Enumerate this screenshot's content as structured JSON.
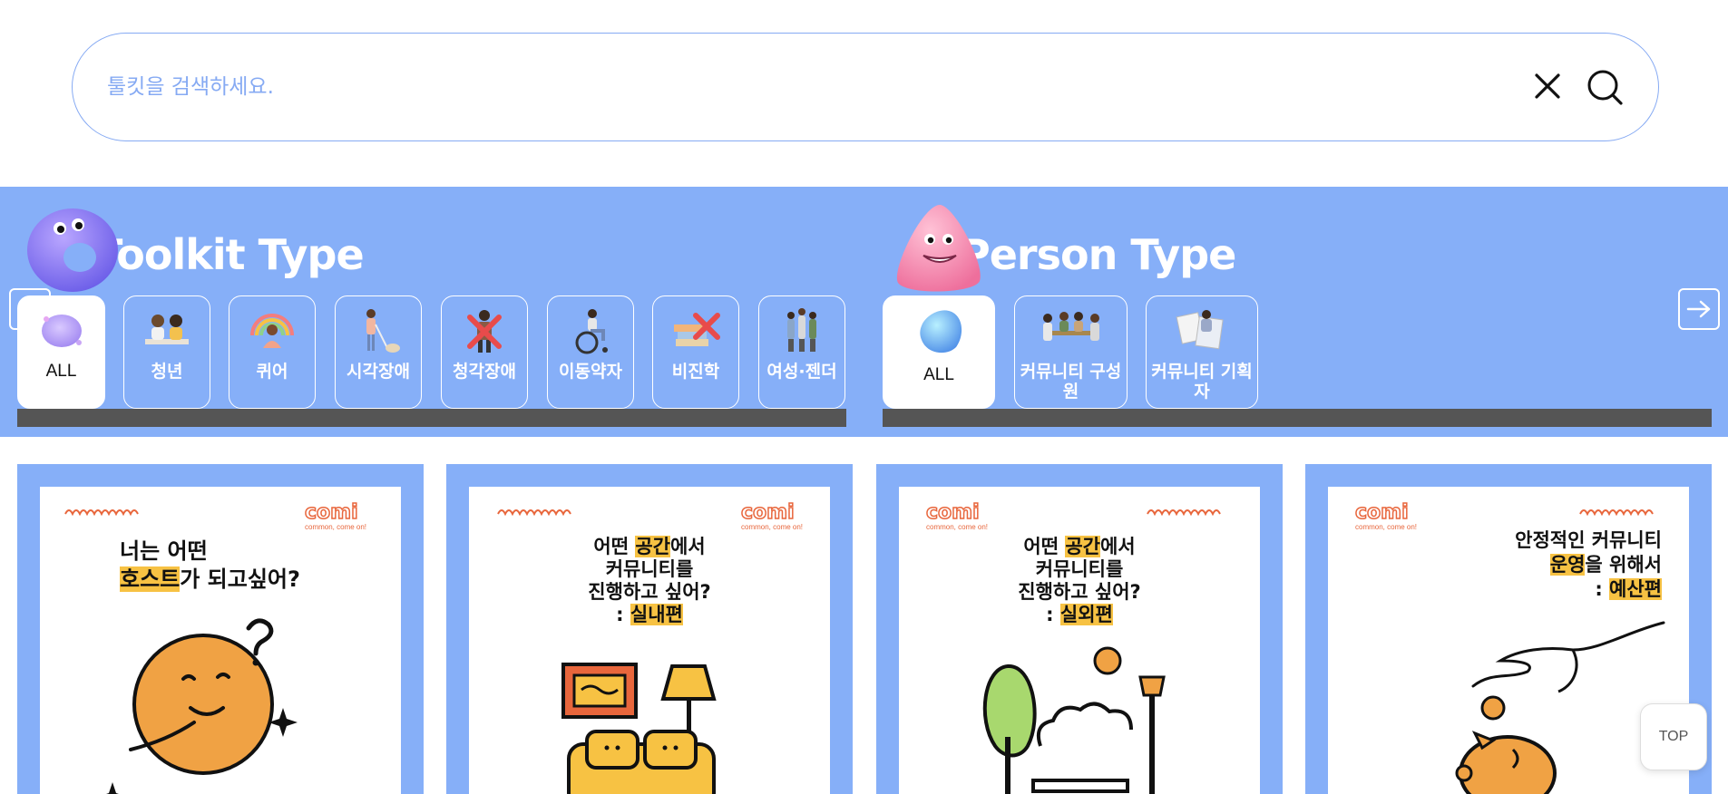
{
  "search": {
    "placeholder": "툴킷을 검색하세요."
  },
  "toolkit_section": {
    "title": "Toolkit Type",
    "chips": [
      {
        "label": "ALL",
        "icon": "blob-icon"
      },
      {
        "label": "청년",
        "icon": "youth-icon"
      },
      {
        "label": "퀴어",
        "icon": "queer-icon"
      },
      {
        "label": "시각장애",
        "icon": "visual-impairment-icon"
      },
      {
        "label": "청각장애",
        "icon": "hearing-impairment-icon"
      },
      {
        "label": "이동약자",
        "icon": "wheelchair-icon"
      },
      {
        "label": "비진학",
        "icon": "books-icon"
      },
      {
        "label": "여성·젠더",
        "icon": "gender-icon"
      }
    ]
  },
  "person_section": {
    "title": "Person Type",
    "chips": [
      {
        "label": "ALL",
        "icon": "crystal-icon"
      },
      {
        "label": "커뮤니티 구성원",
        "icon": "members-icon"
      },
      {
        "label": "커뮤니티 기획자",
        "icon": "planner-icon"
      }
    ]
  },
  "cards": [
    {
      "logo": "comi",
      "logo_sub": "common, come on!",
      "line1": "너는 어떤",
      "line2_hl": "호스트",
      "line2_rest": "가 되고싶어?"
    },
    {
      "logo": "comi",
      "logo_sub": "common, come on!",
      "line1_pre": "어떤 ",
      "line1_hl": "공간",
      "line1_post": "에서",
      "line2": "커뮤니티를",
      "line3": "진행하고 싶어?",
      "line4_pre": ": ",
      "line4_hl": "실내편"
    },
    {
      "logo": "comi",
      "logo_sub": "common, come on!",
      "line1_pre": "어떤 ",
      "line1_hl": "공간",
      "line1_post": "에서",
      "line2": "커뮤니티를",
      "line3": "진행하고 싶어?",
      "line4_pre": ": ",
      "line4_hl": "실외편"
    },
    {
      "logo": "comi",
      "logo_sub": "common, come on!",
      "line1": "안정적인 커뮤니티",
      "line2_hl": "운영",
      "line2_rest": "을 위해서",
      "line3_pre": ": ",
      "line3_hl": "예산편"
    }
  ],
  "top_button": "TOP",
  "colors": {
    "accent": "#86aff8",
    "highlight": "#f7c243",
    "orange": "#f0a244",
    "logo": "#e8663c"
  }
}
